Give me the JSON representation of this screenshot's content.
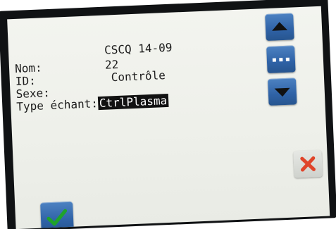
{
  "header": {
    "code": "CSCQ 14-09"
  },
  "fields": [
    {
      "label": "Nom:",
      "value": "22"
    },
    {
      "label": "ID:",
      "value": "Contrôle"
    },
    {
      "label": "Sexe:",
      "value": ""
    },
    {
      "label": "Type échant:",
      "value": "CtrlPlasma"
    }
  ],
  "buttons": {
    "up_icon": "arrow-up-icon",
    "more_icon": "ellipsis-icon",
    "down_icon": "arrow-down-icon",
    "cancel_icon": "close-icon",
    "confirm_icon": "checkmark-icon"
  },
  "colors": {
    "button_blue": "#2f62a6",
    "cancel_red": "#e0442a",
    "confirm_green": "#1fa32a",
    "selection_bg": "#111111"
  }
}
